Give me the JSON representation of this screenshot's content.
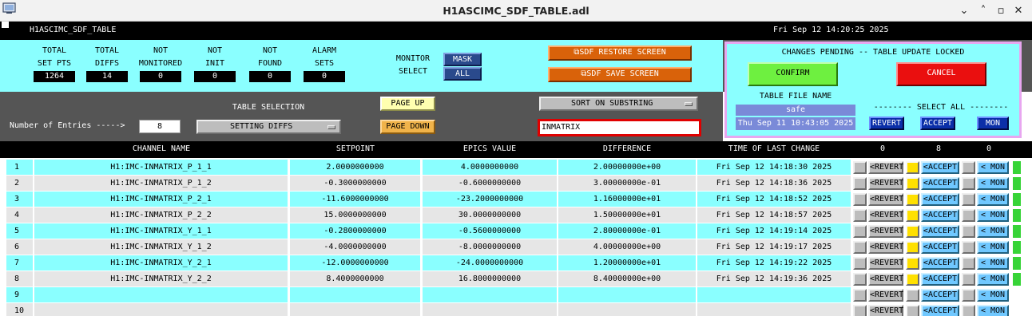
{
  "window": {
    "title": "H1ASCIMC_SDF_TABLE.adl",
    "minimize": "⌄",
    "maximize": "˄",
    "restore": "▫",
    "close": "✕"
  },
  "header": {
    "screen_name": "H1ASCIMC_SDF_TABLE",
    "datetime": "Fri Sep 12 14:20:25 2025"
  },
  "stats": [
    {
      "label_line1": "TOTAL",
      "label_line2": "SET PTS",
      "value": "1264"
    },
    {
      "label_line1": "TOTAL",
      "label_line2": "DIFFS",
      "value": "14"
    },
    {
      "label_line1": "NOT",
      "label_line2": "MONITORED",
      "value": "0"
    },
    {
      "label_line1": "NOT",
      "label_line2": "INIT",
      "value": "0"
    },
    {
      "label_line1": "NOT",
      "label_line2": "FOUND",
      "value": "0"
    },
    {
      "label_line1": "ALARM",
      "label_line2": "SETS",
      "value": "0"
    }
  ],
  "monitor_select": {
    "label_line1": "MONITOR",
    "label_line2": "SELECT",
    "mask": "MASK",
    "all": "ALL"
  },
  "sdf": {
    "restore": "SDF RESTORE SCREEN",
    "save": "SDF SAVE SCREEN"
  },
  "pending": {
    "title": "CHANGES PENDING -- TABLE UPDATE LOCKED",
    "confirm": "CONFIRM",
    "cancel": "CANCEL",
    "file_label": "TABLE FILE NAME",
    "file_name": "safe",
    "file_date": "Thu Sep 11 10:43:05 2025",
    "select_all": "-------- SELECT ALL --------",
    "revert": "REVERT",
    "accept": "ACCEPT",
    "mon": "MON"
  },
  "table_controls": {
    "entries_label": "Number of Entries ----->",
    "entries_value": "8",
    "selection_label": "TABLE SELECTION",
    "selection_value": "SETTING DIFFS",
    "page_up": "PAGE UP",
    "page_down": "PAGE DOWN",
    "sort_label": "SORT ON SUBSTRING",
    "substring": "INMATRIX"
  },
  "table": {
    "columns": [
      "CHANNEL NAME",
      "SETPOINT",
      "EPICS VALUE",
      "DIFFERENCE",
      "TIME OF LAST CHANGE"
    ],
    "count_revert": "0",
    "count_accept": "8",
    "count_mon": "0",
    "revert_label": "<REVERT",
    "accept_label": "<ACCEPT",
    "mon_label": "< MON",
    "rows": [
      {
        "n": "1",
        "channel": "H1:IMC-INMATRIX_P_1_1",
        "setpoint": "2.0000000000",
        "epics": "4.0000000000",
        "diff": "2.00000000e+00",
        "time": "Fri Sep 12 14:18:30 2025",
        "accepted": true
      },
      {
        "n": "2",
        "channel": "H1:IMC-INMATRIX_P_1_2",
        "setpoint": "-0.3000000000",
        "epics": "-0.6000000000",
        "diff": "3.00000000e-01",
        "time": "Fri Sep 12 14:18:36 2025",
        "accepted": true
      },
      {
        "n": "3",
        "channel": "H1:IMC-INMATRIX_P_2_1",
        "setpoint": "-11.6000000000",
        "epics": "-23.2000000000",
        "diff": "1.16000000e+01",
        "time": "Fri Sep 12 14:18:52 2025",
        "accepted": true
      },
      {
        "n": "4",
        "channel": "H1:IMC-INMATRIX_P_2_2",
        "setpoint": "15.0000000000",
        "epics": "30.0000000000",
        "diff": "1.50000000e+01",
        "time": "Fri Sep 12 14:18:57 2025",
        "accepted": true
      },
      {
        "n": "5",
        "channel": "H1:IMC-INMATRIX_Y_1_1",
        "setpoint": "-0.2800000000",
        "epics": "-0.5600000000",
        "diff": "2.80000000e-01",
        "time": "Fri Sep 12 14:19:14 2025",
        "accepted": true
      },
      {
        "n": "6",
        "channel": "H1:IMC-INMATRIX_Y_1_2",
        "setpoint": "-4.0000000000",
        "epics": "-8.0000000000",
        "diff": "4.00000000e+00",
        "time": "Fri Sep 12 14:19:17 2025",
        "accepted": true
      },
      {
        "n": "7",
        "channel": "H1:IMC-INMATRIX_Y_2_1",
        "setpoint": "-12.0000000000",
        "epics": "-24.0000000000",
        "diff": "1.20000000e+01",
        "time": "Fri Sep 12 14:19:22 2025",
        "accepted": true
      },
      {
        "n": "8",
        "channel": "H1:IMC-INMATRIX_Y_2_2",
        "setpoint": "8.4000000000",
        "epics": "16.8000000000",
        "diff": "8.40000000e+00",
        "time": "Fri Sep 12 14:19:36 2025",
        "accepted": true
      },
      {
        "n": "9",
        "channel": "",
        "setpoint": "",
        "epics": "",
        "diff": "",
        "time": "",
        "accepted": false
      },
      {
        "n": "10",
        "channel": "",
        "setpoint": "",
        "epics": "",
        "diff": "",
        "time": "",
        "accepted": false
      }
    ]
  },
  "colors": {
    "cyan": "#8affff",
    "row_alt": "#e6e6e6",
    "highlight": "#ffe000",
    "green": "#37d437"
  }
}
